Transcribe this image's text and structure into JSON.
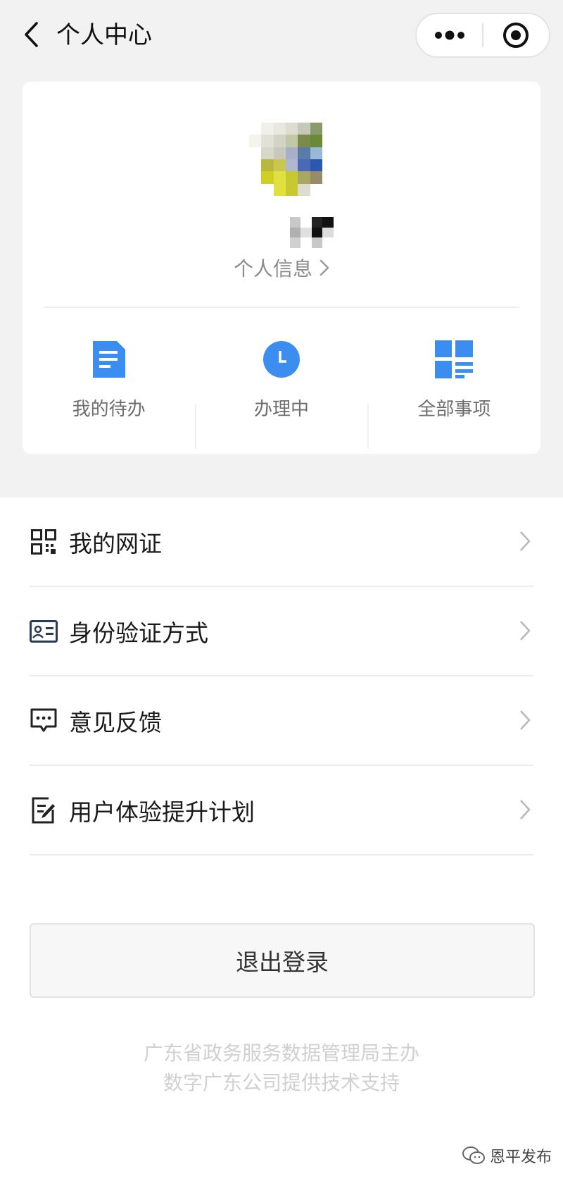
{
  "nav": {
    "title": "个人中心",
    "back_icon": "chevron-left-icon",
    "more_icon": "more-dots-icon",
    "close_icon": "target-circle-icon"
  },
  "profile": {
    "info_link_label": "个人信息",
    "shortcuts": [
      {
        "label": "我的待办",
        "icon": "document-icon"
      },
      {
        "label": "办理中",
        "icon": "clock-icon"
      },
      {
        "label": "全部事项",
        "icon": "grid-icon"
      }
    ]
  },
  "menu": {
    "items": [
      {
        "label": "我的网证",
        "icon": "qr-code-icon"
      },
      {
        "label": "身份验证方式",
        "icon": "id-card-icon"
      },
      {
        "label": "意见反馈",
        "icon": "chat-bubble-icon"
      },
      {
        "label": "用户体验提升计划",
        "icon": "edit-note-icon"
      }
    ]
  },
  "logout": {
    "label": "退出登录"
  },
  "footer": {
    "line1": "广东省政务服务数据管理局主办",
    "line2": "数字广东公司提供技术支持"
  },
  "watermark": {
    "label": "恩平发布",
    "icon": "wechat-icon"
  },
  "colors": {
    "accent_blue": "#3b8ef0",
    "page_bg": "#f2f2f2",
    "card_bg": "#ffffff",
    "muted_text": "#8a8a8a",
    "footer_text": "#d0d0d0",
    "menu_icon_dark": "#2b3a55"
  }
}
